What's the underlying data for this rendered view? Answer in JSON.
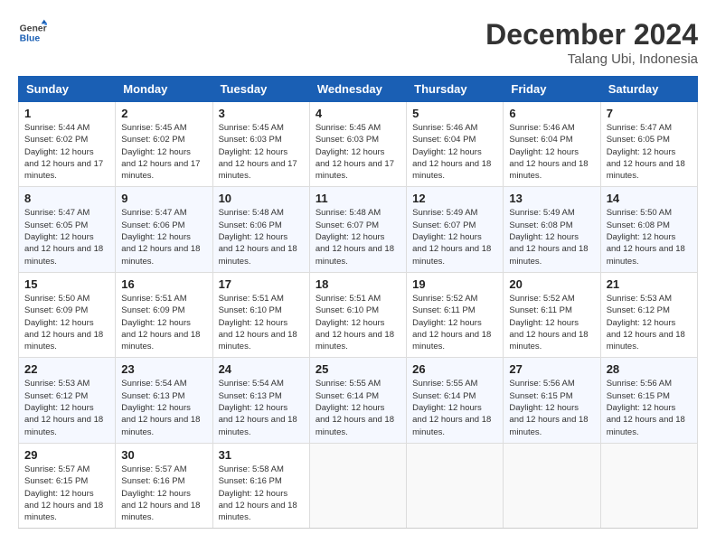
{
  "header": {
    "logo_text_general": "General",
    "logo_text_blue": "Blue",
    "title": "December 2024",
    "subtitle": "Talang Ubi, Indonesia"
  },
  "weekdays": [
    "Sunday",
    "Monday",
    "Tuesday",
    "Wednesday",
    "Thursday",
    "Friday",
    "Saturday"
  ],
  "weeks": [
    [
      {
        "day": "1",
        "sunrise": "5:44 AM",
        "sunset": "6:02 PM",
        "daylight": "12 hours and 17 minutes."
      },
      {
        "day": "2",
        "sunrise": "5:45 AM",
        "sunset": "6:02 PM",
        "daylight": "12 hours and 17 minutes."
      },
      {
        "day": "3",
        "sunrise": "5:45 AM",
        "sunset": "6:03 PM",
        "daylight": "12 hours and 17 minutes."
      },
      {
        "day": "4",
        "sunrise": "5:45 AM",
        "sunset": "6:03 PM",
        "daylight": "12 hours and 17 minutes."
      },
      {
        "day": "5",
        "sunrise": "5:46 AM",
        "sunset": "6:04 PM",
        "daylight": "12 hours and 18 minutes."
      },
      {
        "day": "6",
        "sunrise": "5:46 AM",
        "sunset": "6:04 PM",
        "daylight": "12 hours and 18 minutes."
      },
      {
        "day": "7",
        "sunrise": "5:47 AM",
        "sunset": "6:05 PM",
        "daylight": "12 hours and 18 minutes."
      }
    ],
    [
      {
        "day": "8",
        "sunrise": "5:47 AM",
        "sunset": "6:05 PM",
        "daylight": "12 hours and 18 minutes."
      },
      {
        "day": "9",
        "sunrise": "5:47 AM",
        "sunset": "6:06 PM",
        "daylight": "12 hours and 18 minutes."
      },
      {
        "day": "10",
        "sunrise": "5:48 AM",
        "sunset": "6:06 PM",
        "daylight": "12 hours and 18 minutes."
      },
      {
        "day": "11",
        "sunrise": "5:48 AM",
        "sunset": "6:07 PM",
        "daylight": "12 hours and 18 minutes."
      },
      {
        "day": "12",
        "sunrise": "5:49 AM",
        "sunset": "6:07 PM",
        "daylight": "12 hours and 18 minutes."
      },
      {
        "day": "13",
        "sunrise": "5:49 AM",
        "sunset": "6:08 PM",
        "daylight": "12 hours and 18 minutes."
      },
      {
        "day": "14",
        "sunrise": "5:50 AM",
        "sunset": "6:08 PM",
        "daylight": "12 hours and 18 minutes."
      }
    ],
    [
      {
        "day": "15",
        "sunrise": "5:50 AM",
        "sunset": "6:09 PM",
        "daylight": "12 hours and 18 minutes."
      },
      {
        "day": "16",
        "sunrise": "5:51 AM",
        "sunset": "6:09 PM",
        "daylight": "12 hours and 18 minutes."
      },
      {
        "day": "17",
        "sunrise": "5:51 AM",
        "sunset": "6:10 PM",
        "daylight": "12 hours and 18 minutes."
      },
      {
        "day": "18",
        "sunrise": "5:51 AM",
        "sunset": "6:10 PM",
        "daylight": "12 hours and 18 minutes."
      },
      {
        "day": "19",
        "sunrise": "5:52 AM",
        "sunset": "6:11 PM",
        "daylight": "12 hours and 18 minutes."
      },
      {
        "day": "20",
        "sunrise": "5:52 AM",
        "sunset": "6:11 PM",
        "daylight": "12 hours and 18 minutes."
      },
      {
        "day": "21",
        "sunrise": "5:53 AM",
        "sunset": "6:12 PM",
        "daylight": "12 hours and 18 minutes."
      }
    ],
    [
      {
        "day": "22",
        "sunrise": "5:53 AM",
        "sunset": "6:12 PM",
        "daylight": "12 hours and 18 minutes."
      },
      {
        "day": "23",
        "sunrise": "5:54 AM",
        "sunset": "6:13 PM",
        "daylight": "12 hours and 18 minutes."
      },
      {
        "day": "24",
        "sunrise": "5:54 AM",
        "sunset": "6:13 PM",
        "daylight": "12 hours and 18 minutes."
      },
      {
        "day": "25",
        "sunrise": "5:55 AM",
        "sunset": "6:14 PM",
        "daylight": "12 hours and 18 minutes."
      },
      {
        "day": "26",
        "sunrise": "5:55 AM",
        "sunset": "6:14 PM",
        "daylight": "12 hours and 18 minutes."
      },
      {
        "day": "27",
        "sunrise": "5:56 AM",
        "sunset": "6:15 PM",
        "daylight": "12 hours and 18 minutes."
      },
      {
        "day": "28",
        "sunrise": "5:56 AM",
        "sunset": "6:15 PM",
        "daylight": "12 hours and 18 minutes."
      }
    ],
    [
      {
        "day": "29",
        "sunrise": "5:57 AM",
        "sunset": "6:15 PM",
        "daylight": "12 hours and 18 minutes."
      },
      {
        "day": "30",
        "sunrise": "5:57 AM",
        "sunset": "6:16 PM",
        "daylight": "12 hours and 18 minutes."
      },
      {
        "day": "31",
        "sunrise": "5:58 AM",
        "sunset": "6:16 PM",
        "daylight": "12 hours and 18 minutes."
      },
      null,
      null,
      null,
      null
    ]
  ],
  "labels": {
    "sunrise": "Sunrise:",
    "sunset": "Sunset:",
    "daylight": "Daylight:"
  }
}
